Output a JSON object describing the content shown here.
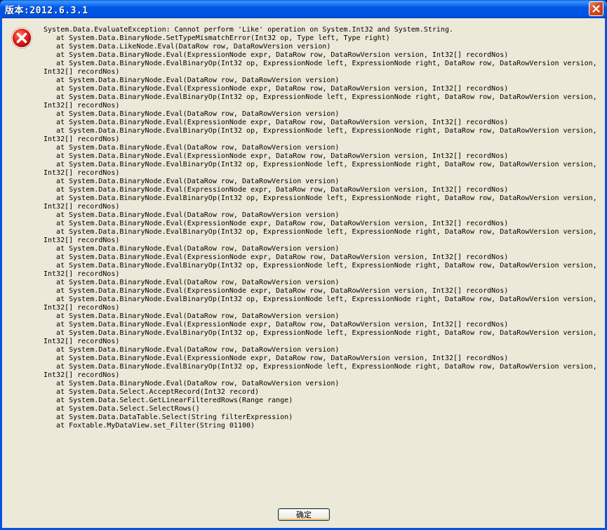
{
  "window": {
    "title": "版本:2012.6.3.1",
    "close_label": "×"
  },
  "dialog": {
    "icon": "error-icon",
    "ok_label": "确定",
    "lines": [
      "System.Data.EvaluateException: Cannot perform 'Like' operation on System.Int32 and System.String.",
      "   at System.Data.BinaryNode.SetTypeMismatchError(Int32 op, Type left, Type right)",
      "   at System.Data.LikeNode.Eval(DataRow row, DataRowVersion version)",
      "   at System.Data.BinaryNode.Eval(ExpressionNode expr, DataRow row, DataRowVersion version, Int32[] recordNos)",
      "   at System.Data.BinaryNode.EvalBinaryOp(Int32 op, ExpressionNode left, ExpressionNode right, DataRow row, DataRowVersion version,",
      "Int32[] recordNos)",
      "   at System.Data.BinaryNode.Eval(DataRow row, DataRowVersion version)",
      "   at System.Data.BinaryNode.Eval(ExpressionNode expr, DataRow row, DataRowVersion version, Int32[] recordNos)",
      "   at System.Data.BinaryNode.EvalBinaryOp(Int32 op, ExpressionNode left, ExpressionNode right, DataRow row, DataRowVersion version,",
      "Int32[] recordNos)",
      "   at System.Data.BinaryNode.Eval(DataRow row, DataRowVersion version)",
      "   at System.Data.BinaryNode.Eval(ExpressionNode expr, DataRow row, DataRowVersion version, Int32[] recordNos)",
      "   at System.Data.BinaryNode.EvalBinaryOp(Int32 op, ExpressionNode left, ExpressionNode right, DataRow row, DataRowVersion version,",
      "Int32[] recordNos)",
      "   at System.Data.BinaryNode.Eval(DataRow row, DataRowVersion version)",
      "   at System.Data.BinaryNode.Eval(ExpressionNode expr, DataRow row, DataRowVersion version, Int32[] recordNos)",
      "   at System.Data.BinaryNode.EvalBinaryOp(Int32 op, ExpressionNode left, ExpressionNode right, DataRow row, DataRowVersion version,",
      "Int32[] recordNos)",
      "   at System.Data.BinaryNode.Eval(DataRow row, DataRowVersion version)",
      "   at System.Data.BinaryNode.Eval(ExpressionNode expr, DataRow row, DataRowVersion version, Int32[] recordNos)",
      "   at System.Data.BinaryNode.EvalBinaryOp(Int32 op, ExpressionNode left, ExpressionNode right, DataRow row, DataRowVersion version,",
      "Int32[] recordNos)",
      "   at System.Data.BinaryNode.Eval(DataRow row, DataRowVersion version)",
      "   at System.Data.BinaryNode.Eval(ExpressionNode expr, DataRow row, DataRowVersion version, Int32[] recordNos)",
      "   at System.Data.BinaryNode.EvalBinaryOp(Int32 op, ExpressionNode left, ExpressionNode right, DataRow row, DataRowVersion version,",
      "Int32[] recordNos)",
      "   at System.Data.BinaryNode.Eval(DataRow row, DataRowVersion version)",
      "   at System.Data.BinaryNode.Eval(ExpressionNode expr, DataRow row, DataRowVersion version, Int32[] recordNos)",
      "   at System.Data.BinaryNode.EvalBinaryOp(Int32 op, ExpressionNode left, ExpressionNode right, DataRow row, DataRowVersion version,",
      "Int32[] recordNos)",
      "   at System.Data.BinaryNode.Eval(DataRow row, DataRowVersion version)",
      "   at System.Data.BinaryNode.Eval(ExpressionNode expr, DataRow row, DataRowVersion version, Int32[] recordNos)",
      "   at System.Data.BinaryNode.EvalBinaryOp(Int32 op, ExpressionNode left, ExpressionNode right, DataRow row, DataRowVersion version,",
      "Int32[] recordNos)",
      "   at System.Data.BinaryNode.Eval(DataRow row, DataRowVersion version)",
      "   at System.Data.BinaryNode.Eval(ExpressionNode expr, DataRow row, DataRowVersion version, Int32[] recordNos)",
      "   at System.Data.BinaryNode.EvalBinaryOp(Int32 op, ExpressionNode left, ExpressionNode right, DataRow row, DataRowVersion version,",
      "Int32[] recordNos)",
      "   at System.Data.BinaryNode.Eval(DataRow row, DataRowVersion version)",
      "   at System.Data.BinaryNode.Eval(ExpressionNode expr, DataRow row, DataRowVersion version, Int32[] recordNos)",
      "   at System.Data.BinaryNode.EvalBinaryOp(Int32 op, ExpressionNode left, ExpressionNode right, DataRow row, DataRowVersion version,",
      "Int32[] recordNos)",
      "   at System.Data.BinaryNode.Eval(DataRow row, DataRowVersion version)",
      "   at System.Data.Select.AcceptRecord(Int32 record)",
      "   at System.Data.Select.GetLinearFilteredRows(Range range)",
      "   at System.Data.Select.SelectRows()",
      "   at System.Data.DataTable.Select(String filterExpression)",
      "   at Foxtable.MyDataView.set_Filter(String 01100)"
    ]
  }
}
